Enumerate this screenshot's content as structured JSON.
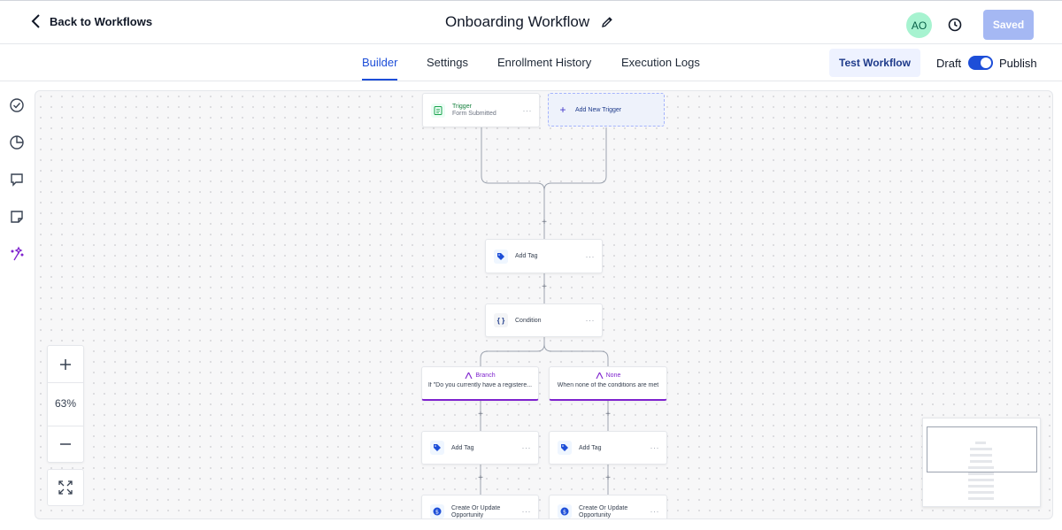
{
  "header": {
    "back_label": "Back to Workflows",
    "title": "Onboarding Workflow",
    "avatar_initials": "AO",
    "saved_label": "Saved",
    "edit_icon": "pencil-icon",
    "history_icon": "clock-history-icon"
  },
  "tabs": [
    {
      "label": "Builder",
      "active": true
    },
    {
      "label": "Settings",
      "active": false
    },
    {
      "label": "Enrollment History",
      "active": false
    },
    {
      "label": "Execution Logs",
      "active": false
    }
  ],
  "actions": {
    "test_label": "Test Workflow",
    "draft_label": "Draft",
    "publish_label": "Publish",
    "publish_on": true
  },
  "rail": [
    "check-circle-icon",
    "pie-chart-icon",
    "comment-icon",
    "note-icon",
    "sparkles-icon"
  ],
  "workflow": {
    "trigger": {
      "label": "Trigger",
      "sub": "Form Submitted"
    },
    "add_trigger": "Add New Trigger",
    "add_tag": "Add Tag",
    "condition": "Condition",
    "branches": [
      {
        "title": "Branch",
        "desc": "If \"Do you currently have a registere..."
      },
      {
        "title": "None",
        "desc": "When none of the conditions are met"
      }
    ],
    "branch_steps": [
      {
        "tag": "Add Tag",
        "opp_line1": "Create Or Update",
        "opp_line2": "Opportunity"
      },
      {
        "tag": "Add Tag",
        "opp_line1": "Create Or Update",
        "opp_line2": "Opportunity"
      }
    ],
    "more": "···",
    "plus": "+"
  },
  "zoom": {
    "level": "63%"
  },
  "colors": {
    "accent": "#1d4ed8",
    "branch": "#7e22ce",
    "trigger": "#15803d",
    "avatar_bg": "#a7f3d0"
  }
}
